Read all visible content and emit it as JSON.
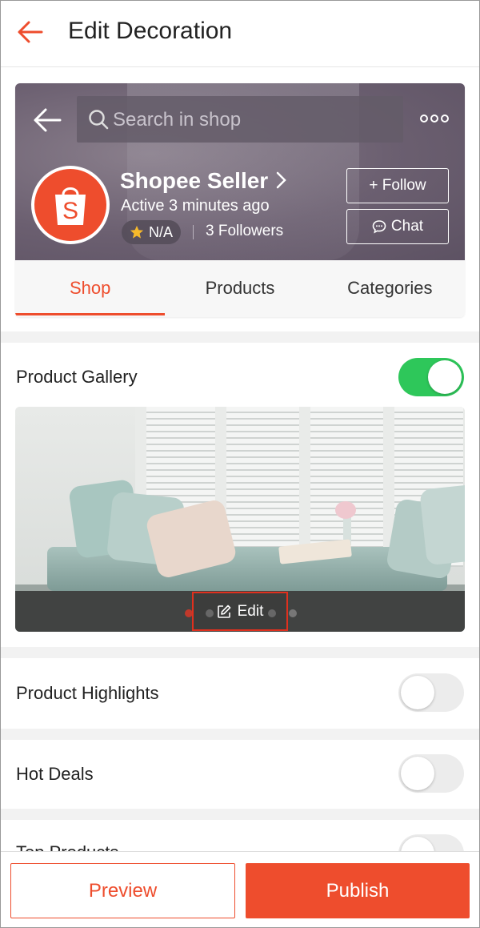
{
  "header": {
    "title": "Edit Decoration"
  },
  "shop_preview": {
    "search_placeholder": "Search in shop",
    "shop_name": "Shopee Seller",
    "active_status": "Active 3 minutes ago",
    "rating": "N/A",
    "followers": "3 Followers",
    "follow_label": "+ Follow",
    "chat_label": "Chat",
    "tabs": [
      {
        "label": "Shop",
        "active": true
      },
      {
        "label": "Products",
        "active": false
      },
      {
        "label": "Categories",
        "active": false
      }
    ],
    "brand_color": "#ee4d2d"
  },
  "sections": [
    {
      "label": "Product Gallery",
      "enabled": true
    },
    {
      "label": "Product Highlights",
      "enabled": false
    },
    {
      "label": "Hot Deals",
      "enabled": false
    },
    {
      "label": "Top Products",
      "enabled": false
    }
  ],
  "gallery": {
    "edit_label": "Edit",
    "slide_count": 4,
    "active_slide": 1
  },
  "footer": {
    "preview_label": "Preview",
    "publish_label": "Publish"
  },
  "colors": {
    "accent": "#ee4d2d",
    "toggle_on": "#2ec75a",
    "toggle_off": "#ececec"
  }
}
